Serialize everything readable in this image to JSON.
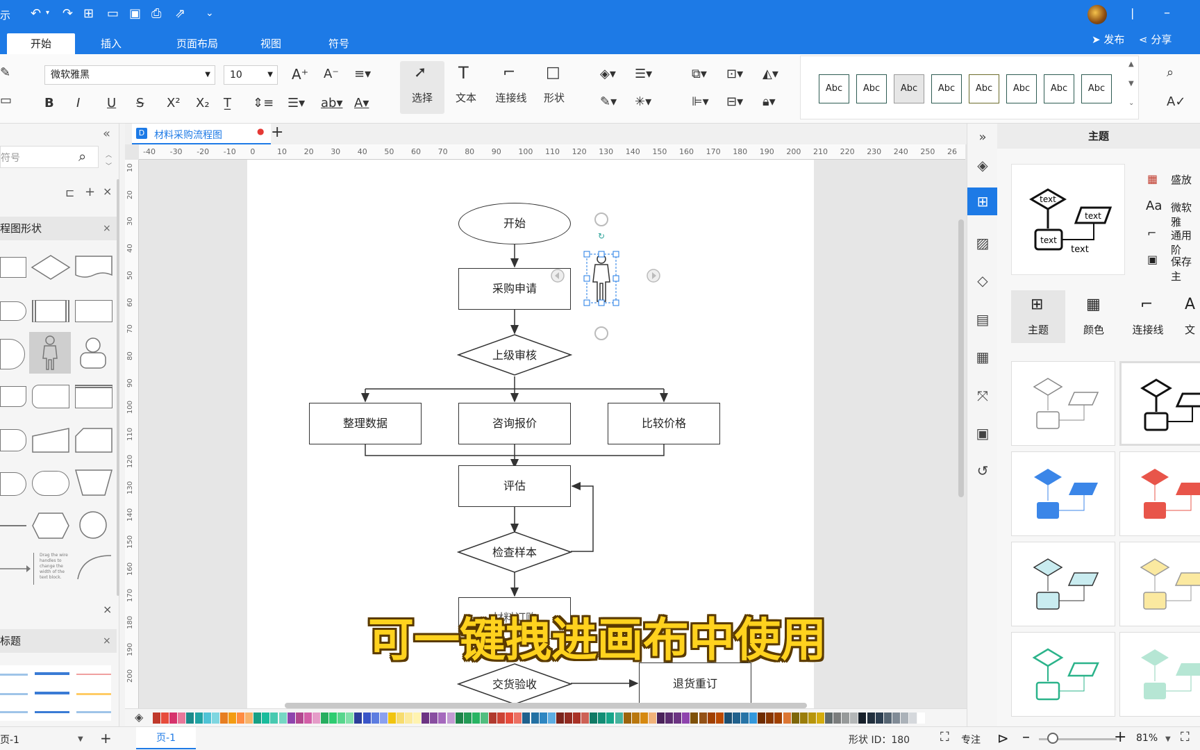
{
  "titlebar": {
    "app_fragment": "示"
  },
  "tabs": [
    "开始",
    "插入",
    "页面布局",
    "视图",
    "符号"
  ],
  "actions": {
    "publish": "发布",
    "share": "分享"
  },
  "ribbon": {
    "font_name": "微软雅黑",
    "font_size": "10",
    "tools": [
      "选择",
      "文本",
      "连接线",
      "形状"
    ],
    "styles": [
      "Abc",
      "Abc",
      "Abc",
      "Abc",
      "Abc",
      "Abc",
      "Abc",
      "Abc"
    ]
  },
  "left_panel": {
    "search_placeholder": "符号",
    "section1": "程图形状",
    "section2": "标题",
    "tiny_text": "Drag the wire handles to change the width of the text block."
  },
  "document": {
    "tab_title": "材料采购流程图"
  },
  "ruler": {
    "h": [
      "-40",
      "-30",
      "-20",
      "-10",
      "0",
      "10",
      "20",
      "30",
      "40",
      "50",
      "60",
      "70",
      "80",
      "90",
      "100",
      "110",
      "120",
      "130",
      "140",
      "150",
      "160",
      "170",
      "180",
      "190",
      "200",
      "210",
      "220",
      "230",
      "240",
      "250",
      "26"
    ],
    "v": [
      "10",
      "20",
      "30",
      "40",
      "50",
      "60",
      "70",
      "80",
      "90",
      "100",
      "110",
      "120",
      "130",
      "140",
      "150",
      "160",
      "170",
      "180",
      "190",
      "200"
    ]
  },
  "flowchart": {
    "start": "开始",
    "request": "采购申请",
    "review": "上级审核",
    "organize": "整理数据",
    "inquire": "咨询报价",
    "compare": "比较价格",
    "evaluate": "评估",
    "check": "检查样本",
    "partial": "材料订购",
    "delivery": "交货验收",
    "return": "退货重订"
  },
  "right_panel": {
    "title": "主题",
    "theme_text": "text",
    "options": [
      "盛放",
      "微软雅",
      "通用阶",
      "保存主"
    ],
    "tabs": [
      "主题",
      "颜色",
      "连接线",
      "文"
    ]
  },
  "status": {
    "page_sel": "页-1",
    "page_tab": "页-1",
    "shape_id": "形状 ID：180",
    "focus": "专注",
    "zoom": "81%"
  },
  "caption": "可一键拽进画布中使用",
  "colors": {
    "accent": "#1d7ae6"
  }
}
